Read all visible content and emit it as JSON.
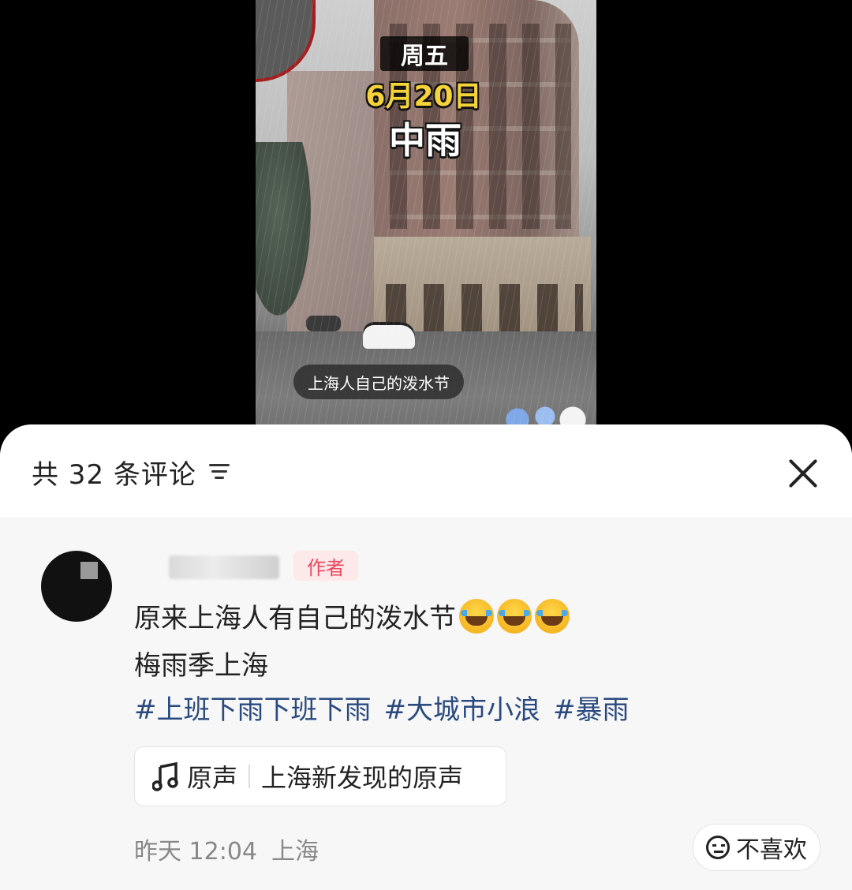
{
  "video": {
    "overlay_day": "周五",
    "overlay_date": "6月20日",
    "overlay_weather": "中雨",
    "caption": "上海人自己的泼水节"
  },
  "comments_panel": {
    "header": {
      "count_label": "共 32 条评论",
      "sort_icon": "sort-lines-icon",
      "close_icon": "close-icon"
    },
    "comment": {
      "author_badge": "作者",
      "text_line1": "原来上海人有自己的泼水节",
      "emoji": "laugh-cry-emoji",
      "emoji_count": 3,
      "text_line2": "梅雨季上海",
      "hashtags": [
        "#上班下雨下班下雨",
        "#大城市小浪",
        "#暴雨"
      ],
      "music": {
        "icon": "music-note-icon",
        "label": "原声",
        "title": "上海新发现的原声"
      },
      "time": "昨天 12:04",
      "location": "上海",
      "dislike_label": "不喜欢",
      "dislike_icon": "neutral-face-icon"
    }
  },
  "colors": {
    "author_badge_bg": "#fde8ea",
    "author_badge_text": "#ec4a5e",
    "hashtag": "#2a4a7f",
    "date_overlay": "#f6d338"
  }
}
